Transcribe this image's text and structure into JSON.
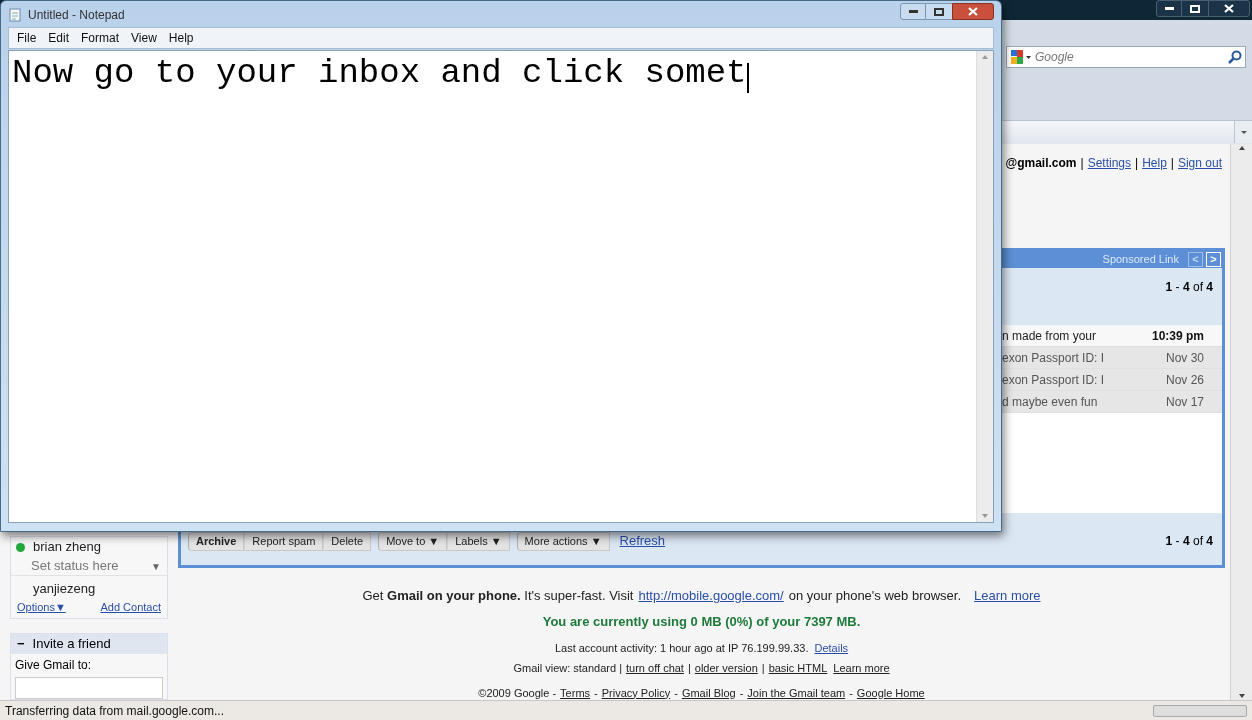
{
  "notepad": {
    "title": "Untitled - Notepad",
    "menu": [
      "File",
      "Edit",
      "Format",
      "View",
      "Help"
    ],
    "text": "Now go to your inbox and click somet"
  },
  "browser": {
    "search": {
      "placeholder": "Google"
    },
    "status_bar": "Transferring data from mail.google.com..."
  },
  "gmail": {
    "account": {
      "email": "@gmail.com",
      "links": [
        {
          "separator": "|",
          "label": "Settings"
        },
        {
          "separator": "|",
          "label": "Help"
        },
        {
          "separator": "|",
          "label": "Sign out"
        }
      ]
    },
    "ad_bar": {
      "label": "Sponsored Link",
      "nav": [
        {
          "label": "<",
          "disabled": true
        },
        {
          "label": ">",
          "disabled": false
        }
      ]
    },
    "count_top": "**1** - **4** of **4**",
    "messages": [
      {
        "snippet": "n made from your",
        "date": "10:39 pm",
        "unread": true
      },
      {
        "snippet": "exon Passport ID: I",
        "date": "Nov 30",
        "unread": false
      },
      {
        "snippet": "exon Passport ID: I",
        "date": "Nov 26",
        "unread": false
      },
      {
        "snippet": "d maybe even fun",
        "date": "Nov 17",
        "unread": false
      }
    ],
    "toolbar": [
      {
        "label": "Archive",
        "bold": true,
        "dropdown": false,
        "group_start": true
      },
      {
        "label": "Report spam",
        "bold": false,
        "dropdown": false,
        "group_start": false
      },
      {
        "label": "Delete",
        "bold": false,
        "dropdown": false,
        "group_start": false
      },
      {
        "label": "Move to",
        "bold": false,
        "dropdown": true,
        "group_start": true
      },
      {
        "label": "Labels",
        "bold": false,
        "dropdown": true,
        "group_start": false
      },
      {
        "label": "More actions",
        "bold": false,
        "dropdown": true,
        "group_start": true
      }
    ],
    "dropdown_mark": "▼",
    "refresh": "Refresh",
    "count_bottom": "**1** - **4** of **4**",
    "chat": {
      "contacts": [
        {
          "name": "brian zheng",
          "online": true
        },
        {
          "name": "yanjiezeng",
          "online": false
        }
      ],
      "status_placeholder": "Set status here",
      "status_caret": "▼",
      "options": "Options▼",
      "add_contact": "Add Contact"
    },
    "invite": {
      "toggle": "−",
      "title": "Invite a friend",
      "label": "Give Gmail to:"
    },
    "footer": {
      "phone_before": "Get **Gmail on your phone.** It's super-fast. Visit",
      "phone_link": "http://mobile.google.com/",
      "phone_after": "on your phone's web browser.",
      "learn_more": "Learn more",
      "usage": "You are currently using 0 MB (0%) of your 7397 MB.",
      "activity": "Last account activity: 1 hour ago at IP 76.199.99.33.",
      "details": "Details",
      "view_label": "Gmail view: standard |",
      "view_links": [
        {
          "label": "turn off chat"
        },
        {
          "separator": "|",
          "label": "older version"
        },
        {
          "separator": "|",
          "label": "basic HTML"
        }
      ],
      "view_learn": "Learn more",
      "copyright": "©2009 Google -",
      "links": [
        {
          "label": "Terms"
        },
        {
          "separator": "-",
          "label": "Privacy Policy"
        },
        {
          "separator": "-",
          "label": "Gmail Blog"
        },
        {
          "separator": "-",
          "label": "Join the Gmail team"
        },
        {
          "separator": "-",
          "label": "Google Home"
        }
      ]
    }
  }
}
